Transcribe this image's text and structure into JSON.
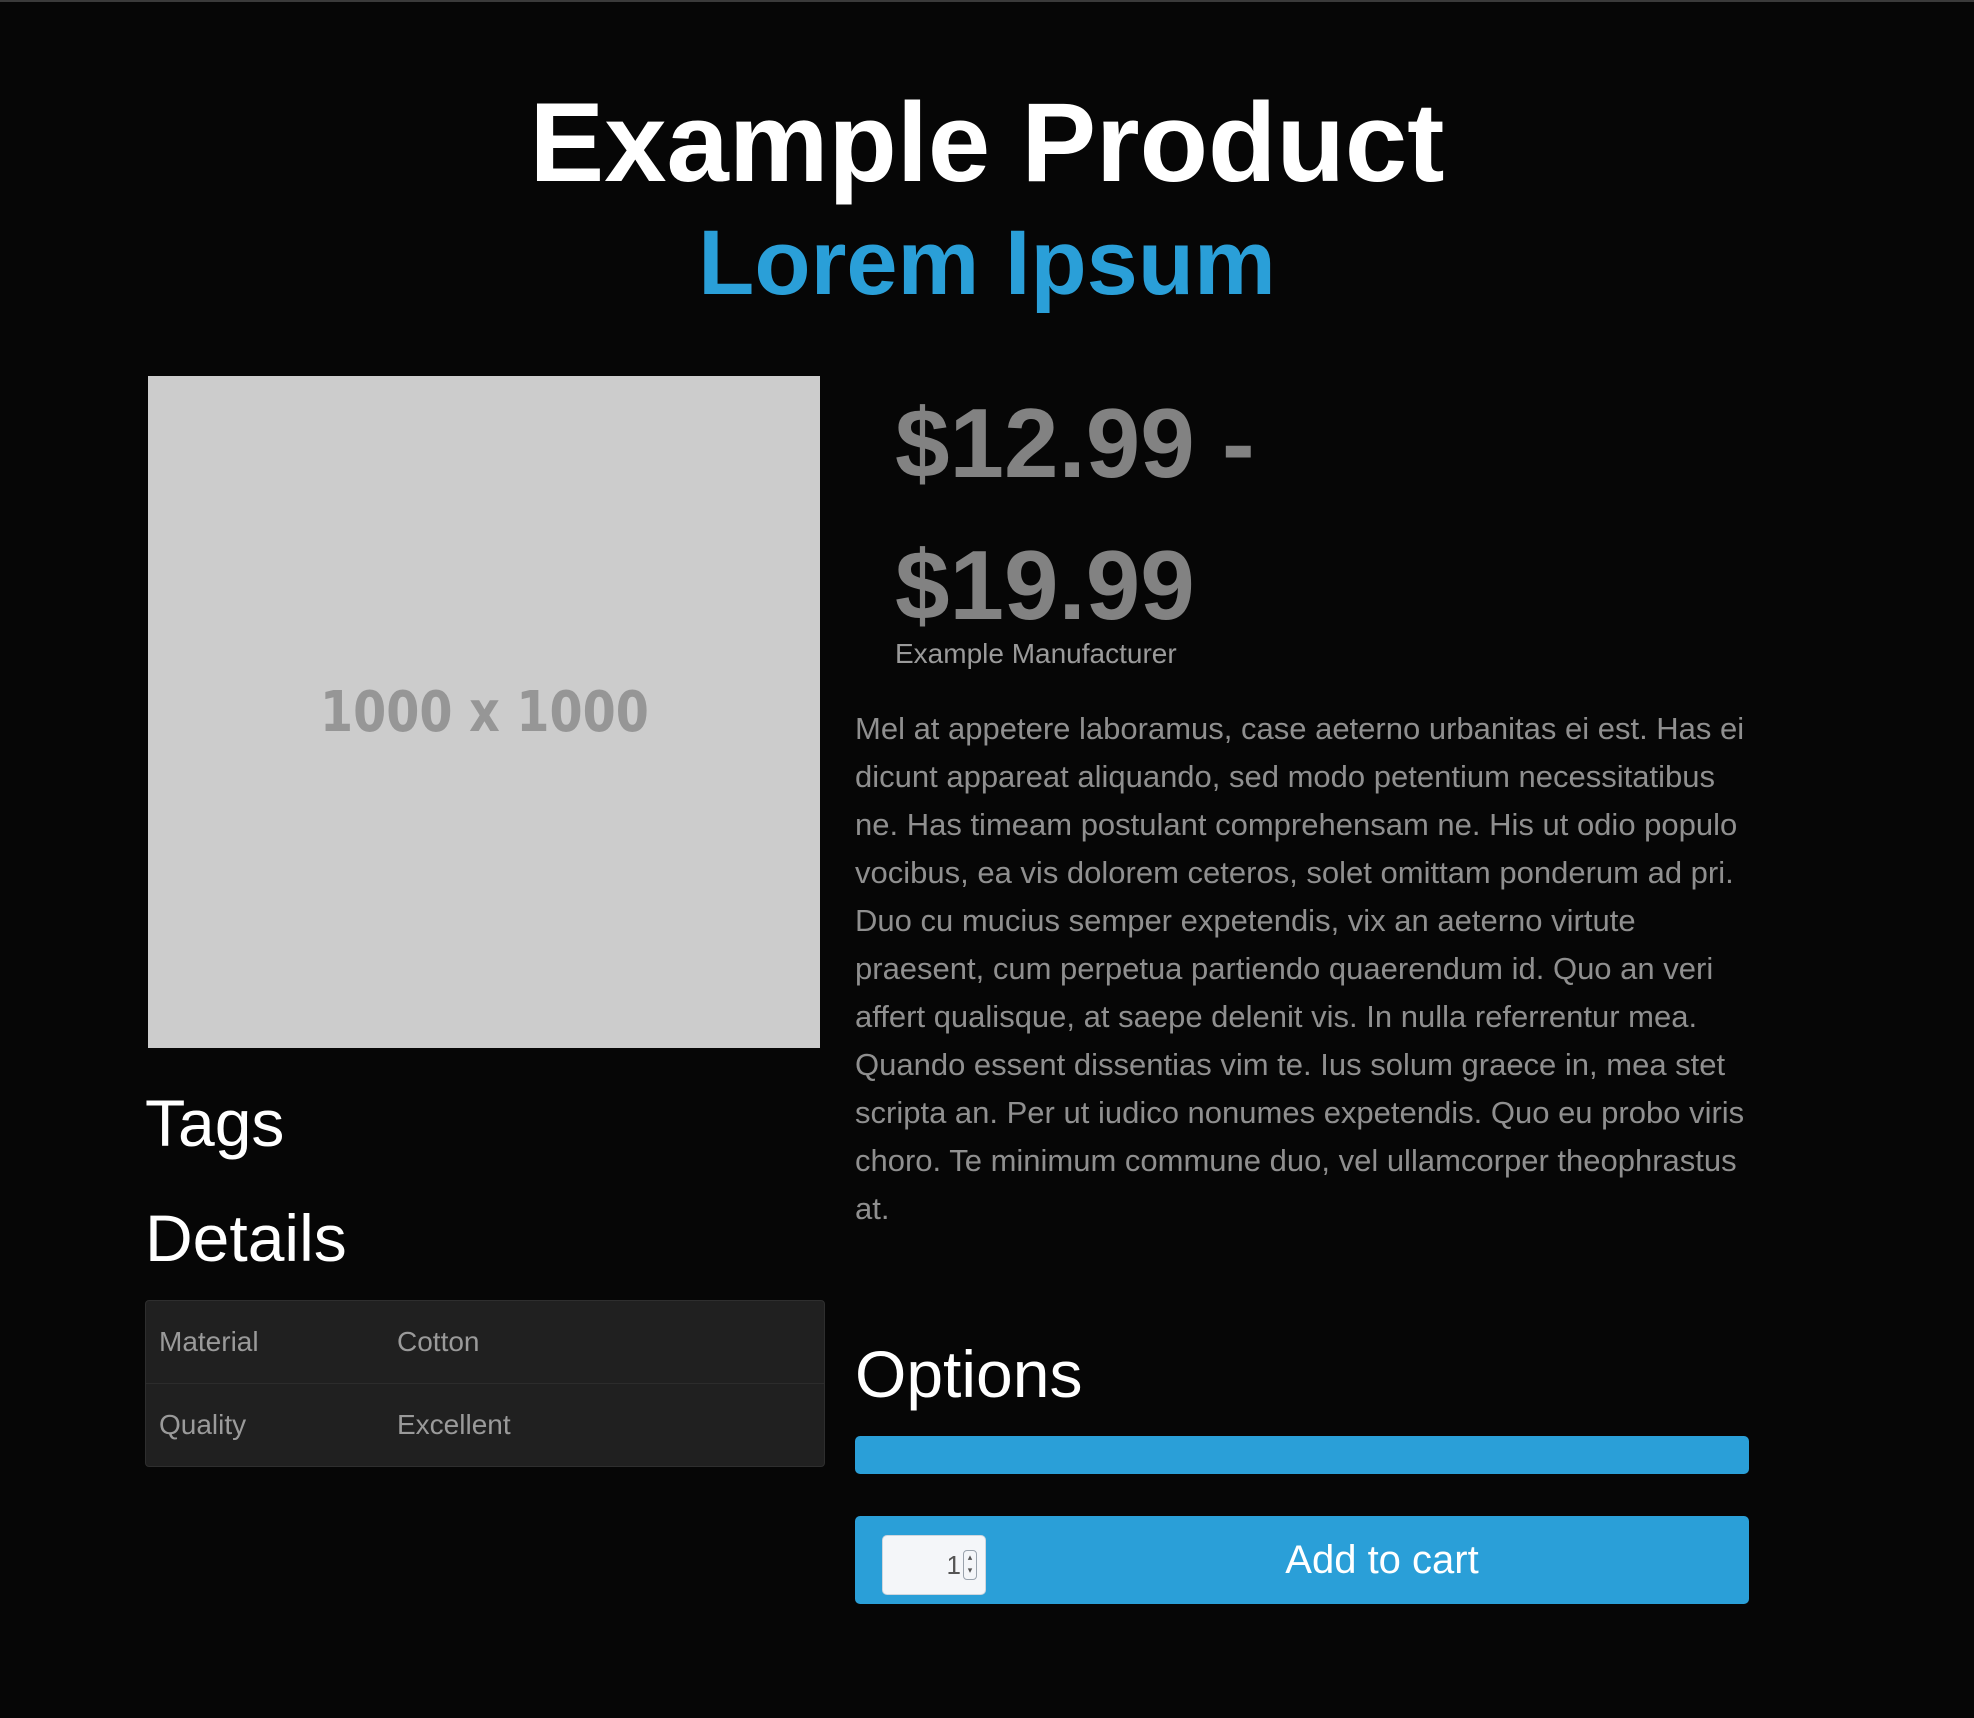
{
  "product": {
    "title": "Example Product",
    "subtitle": "Lorem Ipsum",
    "image_placeholder": "1000 x 1000",
    "price": "$12.99 - $19.99",
    "manufacturer": "Example Manufacturer",
    "description": "Mel at appetere laboramus, case aeterno urbanitas ei est. Has ei dicunt appareat aliquando, sed modo petentium necessitatibus ne. Has timeam postulant comprehensam ne. His ut odio populo vocibus, ea vis dolorem ceteros, solet omittam ponderum ad pri. Duo cu mucius semper expetendis, vix an aeterno virtute praesent, cum perpetua partiendo quaerendum id. Quo an veri affert qualisque, at saepe delenit vis. In nulla referrentur mea. Quando essent dissentias vim te. Ius solum graece in, mea stet scripta an. Per ut iudico nonumes expetendis. Quo eu probo viris choro. Te minimum commune duo, vel ullamcorper theophrastus at."
  },
  "sections": {
    "tags_heading": "Tags",
    "details_heading": "Details",
    "options_heading": "Options"
  },
  "details": [
    {
      "key": "Material",
      "value": "Cotton"
    },
    {
      "key": "Quality",
      "value": "Excellent"
    }
  ],
  "cart": {
    "quantity": "1",
    "add_label": "Add to cart"
  },
  "colors": {
    "accent": "#2a9fd8",
    "background": "#060606",
    "placeholder": "#cccccc"
  },
  "icons": {
    "quantity_spinner": "up-down-arrows-icon"
  }
}
